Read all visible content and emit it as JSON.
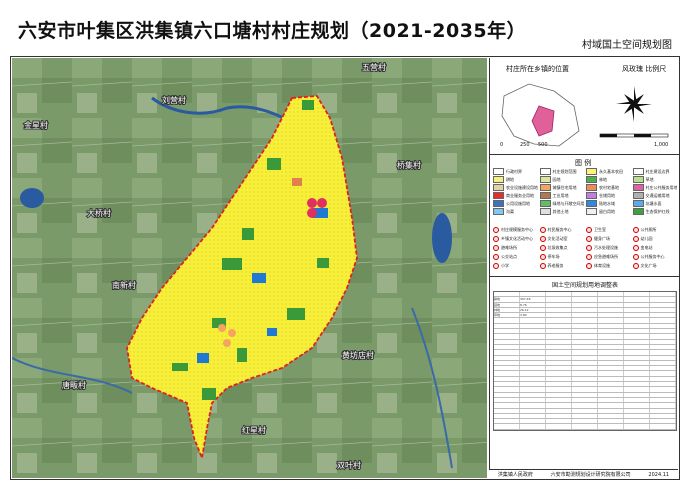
{
  "title": "六安市叶集区洪集镇六口塘村村庄规划（2021-2035年）",
  "subtitle": "村域国土空间规划图",
  "map": {
    "place_labels": [
      "刘营村",
      "五营村",
      "金星村",
      "桥集村",
      "大桥村",
      "南新村",
      "唐畈村",
      "黄坊店村",
      "红星村",
      "双叶村"
    ]
  },
  "panel": {
    "location_title": "村庄所在乡镇的位置",
    "compass_title": "风玫瑰 比例尺",
    "scale_labels": [
      "0",
      "250",
      "500",
      "1,000"
    ],
    "legend_title": "图 例",
    "legend_items": [
      {
        "label": "行政村界",
        "color": "#ffffff"
      },
      {
        "label": "村庄规划范围",
        "color": "#ffffff"
      },
      {
        "label": "永久基本农田",
        "color": "#fff27a"
      },
      {
        "label": "村庄建设边界",
        "color": "#ffffff"
      },
      {
        "label": "耕地",
        "color": "#f5f080"
      },
      {
        "label": "园地",
        "color": "#d8e6a0"
      },
      {
        "label": "林地",
        "color": "#4caf50"
      },
      {
        "label": "草地",
        "color": "#b8e08c"
      },
      {
        "label": "农业设施建设用地",
        "color": "#e6d2a0"
      },
      {
        "label": "城镇住宅用地",
        "color": "#f4a460"
      },
      {
        "label": "农村宅基地",
        "color": "#f08c5a"
      },
      {
        "label": "村庄公共服务用地",
        "color": "#e060a0"
      },
      {
        "label": "商业服务业用地",
        "color": "#e03030"
      },
      {
        "label": "工业用地",
        "color": "#b07850"
      },
      {
        "label": "仓储用地",
        "color": "#c080e0"
      },
      {
        "label": "交通运输用地",
        "color": "#b0b0b0"
      },
      {
        "label": "公用设施用地",
        "color": "#4070c0"
      },
      {
        "label": "绿地与开敞空间用地",
        "color": "#60c060"
      },
      {
        "label": "陆地水域",
        "color": "#2e8ae6"
      },
      {
        "label": "坑塘水面",
        "color": "#5aaaf0"
      },
      {
        "label": "沟渠",
        "color": "#80c8f0"
      },
      {
        "label": "其他土地",
        "color": "#e0e0e0"
      },
      {
        "label": "留白用地",
        "color": "#f0f0f0"
      },
      {
        "label": "生态保护红线",
        "color": "#40a040"
      }
    ],
    "symbol_items": [
      "村庄规模服务中心",
      "村民服务中心",
      "卫生室",
      "公共厕所",
      "乡镇文化活动中心",
      "文化活动室",
      "健身广场",
      "幼儿园",
      "避难场所",
      "垃圾收集点",
      "污水处理设施",
      "变电站",
      "公交站点",
      "停车场",
      "应急避难场所",
      "公共服务中心",
      "小学",
      "养老服务",
      "体育设施",
      "文化广场"
    ],
    "table_title": "国土空间规划用地调整表",
    "table_rows": [
      [
        "",
        "",
        "",
        "",
        "",
        "",
        ""
      ],
      [
        "耕地",
        "397.46",
        "",
        "",
        "",
        "",
        ""
      ],
      [
        "园地",
        "8.76",
        "",
        "",
        "",
        "",
        ""
      ],
      [
        "林地",
        "26.12",
        "",
        "",
        "",
        "",
        ""
      ],
      [
        "草地",
        "3.80",
        "",
        "",
        "",
        "",
        ""
      ],
      [
        "",
        "",
        "",
        "",
        "",
        "",
        ""
      ],
      [
        "",
        "",
        "",
        "",
        "",
        "",
        ""
      ],
      [
        "",
        "",
        "",
        "",
        "",
        "",
        ""
      ],
      [
        "",
        "",
        "",
        "",
        "",
        "",
        ""
      ],
      [
        "",
        "",
        "",
        "",
        "",
        "",
        ""
      ],
      [
        "",
        "",
        "",
        "",
        "",
        "",
        ""
      ],
      [
        "",
        "",
        "",
        "",
        "",
        "",
        ""
      ],
      [
        "",
        "",
        "",
        "",
        "",
        "",
        ""
      ],
      [
        "",
        "",
        "",
        "",
        "",
        "",
        ""
      ],
      [
        "",
        "",
        "",
        "",
        "",
        "",
        ""
      ],
      [
        "",
        "",
        "",
        "",
        "",
        "",
        ""
      ],
      [
        "",
        "",
        "",
        "",
        "",
        "",
        ""
      ],
      [
        "",
        "",
        "",
        "",
        "",
        "",
        ""
      ],
      [
        "",
        "",
        "",
        "",
        "",
        "",
        ""
      ],
      [
        "",
        "",
        "",
        "",
        "",
        "",
        ""
      ],
      [
        "",
        "",
        "",
        "",
        "",
        "",
        ""
      ],
      [
        "",
        "",
        "",
        "",
        "",
        "",
        ""
      ],
      [
        "",
        "",
        "",
        "",
        "",
        "",
        ""
      ],
      [
        "",
        "",
        "",
        "",
        "",
        "",
        ""
      ],
      [
        "",
        "",
        "",
        "",
        "",
        "",
        ""
      ],
      [
        "",
        "",
        "",
        "",
        "",
        "",
        ""
      ],
      [
        "",
        "",
        "",
        "",
        "",
        "",
        ""
      ],
      [
        "",
        "",
        "",
        "",
        "",
        "",
        ""
      ],
      [
        "",
        "",
        "",
        "",
        "",
        "",
        ""
      ],
      [
        "",
        "",
        "",
        "",
        "",
        "",
        ""
      ]
    ],
    "footer": {
      "org1": "洪集镇人民政府",
      "org2": "六安市勘测规划设计研究院有限公司",
      "date": "2024.11"
    }
  },
  "colors": {
    "farmland": "#f7ef3a",
    "forest": "#3a9a3a",
    "water": "#1f78d1",
    "boundary": "#e02020",
    "residential": "#f4a460",
    "service": "#e03060"
  }
}
